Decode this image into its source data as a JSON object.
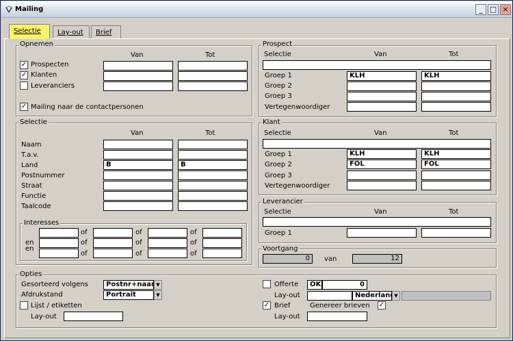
{
  "window": {
    "title": "Mailing",
    "min_icon": "minimize-icon",
    "max_icon": "maximize-icon",
    "close_icon": "close-icon"
  },
  "tabs": [
    {
      "label": "Selectie"
    },
    {
      "label": "Lay-out"
    },
    {
      "label": "Brief"
    }
  ],
  "opnemen": {
    "title": "Opnemen",
    "van": "Van",
    "tot": "Tot",
    "rows": [
      {
        "label": "Prospecten",
        "checked": true,
        "van": "",
        "tot": ""
      },
      {
        "label": "Klanten",
        "checked": true,
        "van": "",
        "tot": ""
      },
      {
        "label": "Leveranciers",
        "checked": false,
        "van": "",
        "tot": ""
      }
    ],
    "contact_label": "Mailing naar de contactpersonen",
    "contact_checked": true
  },
  "selectie": {
    "title": "Selectie",
    "van": "Van",
    "tot": "Tot",
    "rows": [
      {
        "label": "Naam",
        "van": "",
        "tot": ""
      },
      {
        "label": "T.a.v.",
        "van": "",
        "tot": ""
      },
      {
        "label": "Land",
        "van": "B",
        "tot": "B"
      },
      {
        "label": "Postnummer",
        "van": "",
        "tot": ""
      },
      {
        "label": "Straat",
        "van": "",
        "tot": ""
      },
      {
        "label": "Functie",
        "van": "",
        "tot": ""
      },
      {
        "label": "Taalcode",
        "van": "",
        "tot": ""
      }
    ]
  },
  "interesses": {
    "title": "Interesses",
    "en": "en",
    "of": "of"
  },
  "prospect": {
    "title": "Prospect",
    "selectie": "Selectie",
    "van": "Van",
    "tot": "Tot",
    "rows": [
      {
        "label": "Groep 1",
        "van": "KLH",
        "tot": "KLH"
      },
      {
        "label": "Groep 2",
        "van": "",
        "tot": ""
      },
      {
        "label": "Groep 3",
        "van": "",
        "tot": ""
      },
      {
        "label": "Vertegenwoordiger",
        "van": "",
        "tot": ""
      }
    ]
  },
  "klant": {
    "title": "Klant",
    "selectie": "Selectie",
    "van": "Van",
    "tot": "Tot",
    "rows": [
      {
        "label": "Groep 1",
        "van": "KLH",
        "tot": "KLH"
      },
      {
        "label": "Groep 2",
        "van": "FOL",
        "tot": "FOL"
      },
      {
        "label": "Groep 3",
        "van": "",
        "tot": ""
      },
      {
        "label": "Vertegenwoordiger",
        "van": "",
        "tot": ""
      }
    ]
  },
  "leverancier": {
    "title": "Leverancier",
    "selectie": "Selectie",
    "van": "Van",
    "tot": "Tot",
    "rows": [
      {
        "label": "Groep 1",
        "van": "",
        "tot": ""
      }
    ]
  },
  "voortgang": {
    "title": "Voortgang",
    "current": "0",
    "van": "van",
    "total": "12"
  },
  "opties": {
    "title": "Opties",
    "gesorteerd_label": "Gesorteerd volgens",
    "gesorteerd_value": "Postnr+naam",
    "afdrukstand_label": "Afdrukstand",
    "afdrukstand_value": "Portrait",
    "lijst_label": "Lijst / etiketten",
    "lijst_checked": false,
    "layout_label": "Lay-out",
    "layout_value": "",
    "offerte_label": "Offerte",
    "offerte_checked": false,
    "offerte_ok": "OK",
    "offerte_value": "0",
    "offerte_layout_label": "Lay-out",
    "offerte_layout_value": "",
    "offerte_lang": "Nederland",
    "brief_label": "Brief",
    "brief_checked": true,
    "genereer_label": "Genereer brieven",
    "genereer_checked": true,
    "brief_layout_label": "Lay-out",
    "brief_layout_value": ""
  }
}
